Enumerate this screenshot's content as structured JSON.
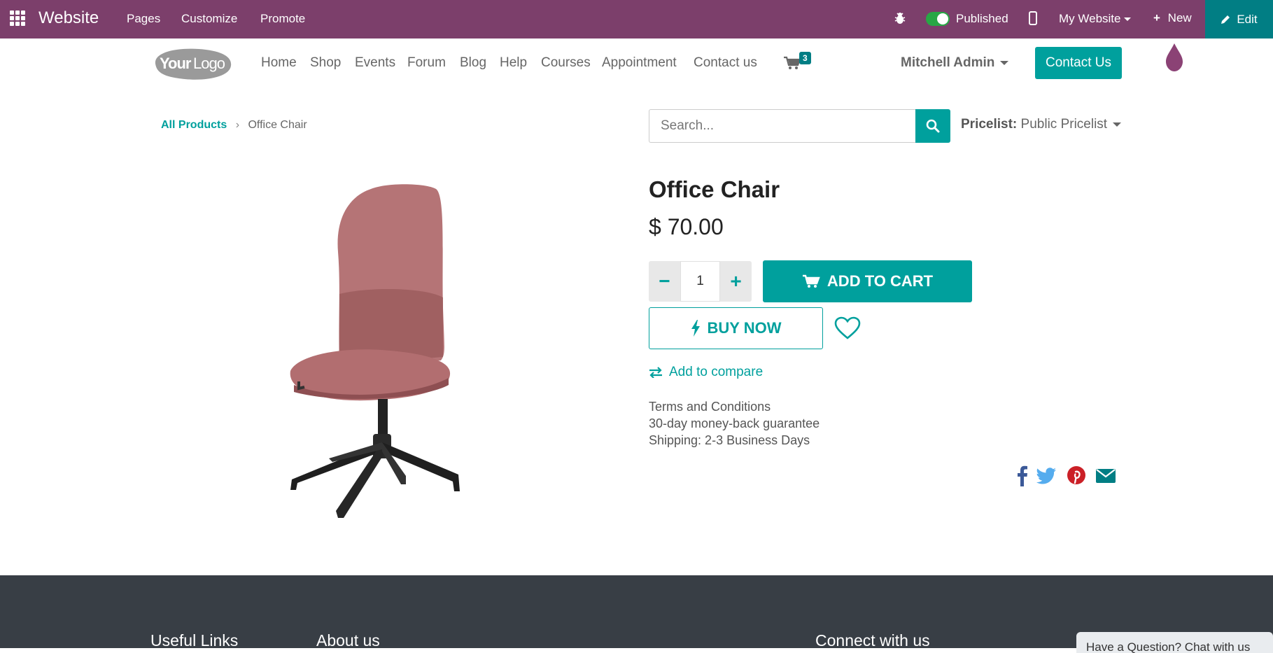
{
  "topbar": {
    "brand": "Website",
    "menu": [
      "Pages",
      "Customize",
      "Promote"
    ],
    "published_label": "Published",
    "website_label": "My Website",
    "new_label": "New",
    "edit_label": "Edit",
    "bg_color": "#7c3f6b",
    "edit_color": "#017e84"
  },
  "header": {
    "logo_text": "YourLogo",
    "nav": [
      "Home",
      "Shop",
      "Events",
      "Forum",
      "Blog",
      "Help",
      "Courses",
      "Appointment",
      "Contact us"
    ],
    "cart_count": "3",
    "user": "Mitchell Admin",
    "contact_button": "Contact Us"
  },
  "breadcrumb": {
    "parent": "All Products",
    "current": "Office Chair"
  },
  "search": {
    "placeholder": "Search..."
  },
  "pricelist": {
    "label": "Pricelist:",
    "value": "Public Pricelist"
  },
  "product": {
    "name": "Office Chair",
    "price": "$ 70.00",
    "quantity": "1",
    "add_to_cart": "ADD TO CART",
    "buy_now": "BUY NOW",
    "compare": "Add to compare",
    "terms": [
      "Terms and Conditions",
      "30-day money-back guarantee",
      "Shipping: 2-3 Business Days"
    ],
    "accent_color": "#00a09d"
  },
  "share_icons": [
    "facebook-icon",
    "twitter-icon",
    "pinterest-icon",
    "email-icon"
  ],
  "footer": {
    "useful_links": "Useful Links",
    "about_us": "About us",
    "connect": "Connect with us",
    "chat_tab": "Have a Question? Chat with us"
  }
}
